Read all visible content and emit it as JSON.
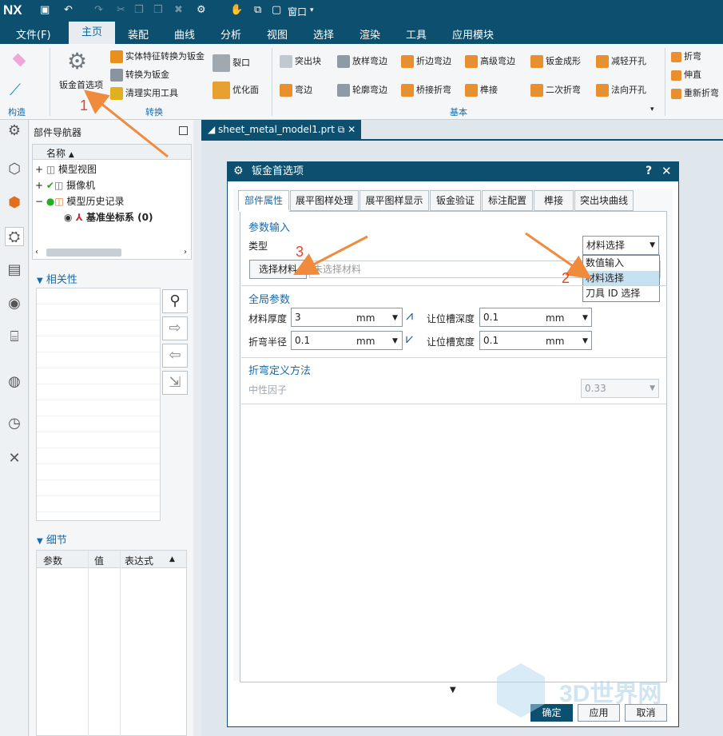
{
  "app": {
    "logo": "NX",
    "window_menu": "窗口"
  },
  "menubar": {
    "file": "文件(F)",
    "home": "主页",
    "assembly": "装配",
    "curve": "曲线",
    "analysis": "分析",
    "view": "视图",
    "select": "选择",
    "render": "渲染",
    "tools": "工具",
    "app_module": "应用模块"
  },
  "ribbon": {
    "sheet_metal_pref": "钣金首选项",
    "convert_solid": "实体特征转换为钣金",
    "convert_to_sm": "转换为钣金",
    "cleanup": "清理实用工具",
    "rip": "裂口",
    "optimize": "优化面",
    "tab_feature": "突出块",
    "flange": "弯边",
    "lofted_flange": "放样弯边",
    "contour_flange": "轮廓弯边",
    "jog": "折边弯边",
    "bridge_bend": "桥接折弯",
    "adv_flange": "高级弯边",
    "mortise": "榫接",
    "sm_forming": "钣金成形",
    "secondary_bend": "二次折弯",
    "lighten_hole": "减轻开孔",
    "normal_cutout": "法向开孔",
    "bend": "折弯",
    "unbend": "伸直",
    "rebend": "重新折弯",
    "group_construct": "构造",
    "group_convert": "转换",
    "group_basic": "基本"
  },
  "navigator": {
    "title": "部件导航器",
    "col_name": "名称",
    "items": [
      "模型视图",
      "摄像机",
      "模型历史记录",
      "基准坐标系 (0)"
    ],
    "relevance": "相关性",
    "details": "细节",
    "detail_cols": [
      "参数",
      "值",
      "表达式"
    ]
  },
  "document": {
    "tab": "sheet_metal_model1.prt"
  },
  "dialog": {
    "title": "钣金首选项",
    "tabs": [
      "部件属性",
      "展平图样处理",
      "展平图样显示",
      "钣金验证",
      "标注配置",
      "榫接",
      "突出块曲线"
    ],
    "param_input": "参数输入",
    "type_label": "类型",
    "type_value": "材料选择",
    "type_options": [
      "数值输入",
      "材料选择",
      "刀具 ID 选择"
    ],
    "select_material": "选择材料",
    "no_material": "未选择材料",
    "global_params": "全局参数",
    "thickness_label": "材料厚度",
    "thickness_value": "3",
    "relief_depth_label": "让位槽深度",
    "relief_depth_value": "0.1",
    "bend_radius_label": "折弯半径",
    "bend_radius_value": "0.1",
    "relief_width_label": "让位槽宽度",
    "relief_width_value": "0.1",
    "unit": "mm",
    "bend_method": "折弯定义方法",
    "neutral_factor_label": "中性因子",
    "neutral_factor_value": "0.33",
    "ok": "确定",
    "apply": "应用",
    "cancel": "取消"
  },
  "annotations": {
    "n1": "1",
    "n2": "2",
    "n3": "3"
  },
  "watermark": "3D世界网",
  "colors": {
    "titlebar": "#0c4f6e",
    "accent": "#1a6aa8",
    "arrow": "#f08a3c",
    "annotation": "#e8432a"
  }
}
